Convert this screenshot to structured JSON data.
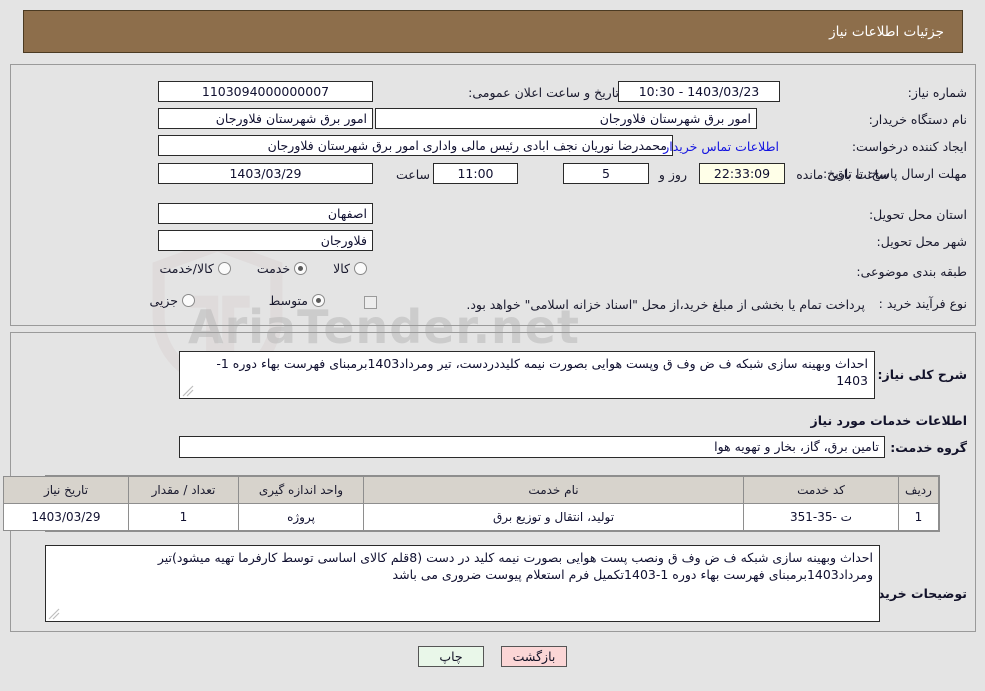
{
  "header": {
    "title": "جزئیات اطلاعات نیاز",
    "bg_color": "#8d6e4b",
    "text_color": "#ffffff"
  },
  "watermark": {
    "text": "AriaTender.net",
    "icon": "shield-icon"
  },
  "form": {
    "need_number_label": "شماره نیاز:",
    "need_number_value": "1103094000000007",
    "announce_datetime_label": "تاریخ و ساعت اعلان عمومی:",
    "announce_datetime_value": "1403/03/23 - 10:30",
    "buyer_org_label": "نام دستگاه خریدار:",
    "buyer_org_value": "امور برق شهرستان فلاورجان",
    "buyer_org_value2": "امور برق شهرستان فلاورجان",
    "requester_label": "ایجاد کننده درخواست:",
    "requester_value": "محمدرضا نوریان نجف ابادی رئیس مالی واداری  امور برق شهرستان فلاورجان",
    "contact_link_label": "اطلاعات تماس خریدار",
    "deadline_label": "مهلت ارسال پاسخ: تا تاریخ:",
    "deadline_date_value": "1403/03/29",
    "hour_label": "ساعت",
    "hour_value": "11:00",
    "days_value": "5",
    "days_label": "روز و",
    "countdown_value": "22:33:09",
    "remaining_label": "ساعت باقی مانده",
    "province_label": "استان محل تحویل:",
    "province_value": "اصفهان",
    "city_label": "شهر محل تحویل:",
    "city_value": "فلاورجان",
    "category_label": "طبقه بندی موضوعی:",
    "category_options": [
      {
        "label": "کالا",
        "selected": false
      },
      {
        "label": "خدمت",
        "selected": true
      },
      {
        "label": "کالا/خدمت",
        "selected": false
      }
    ],
    "process_label": "نوع فرآیند خرید :",
    "process_options": [
      {
        "label": "جزیی",
        "selected": false
      },
      {
        "label": "متوسط",
        "selected": true
      }
    ],
    "treasury_checkbox_checked": false,
    "treasury_note": "پرداخت تمام یا بخشی از مبلغ خرید،از محل \"اسناد خزانه اسلامی\" خواهد بود."
  },
  "summary": {
    "label": "شرح کلی نیاز:",
    "value": "احداث وبهینه سازی شبکه ف ض وف ق وپست هوایی بصورت نیمه کلیددردست، تیر ومرداد1403برمبنای فهرست بهاء دوره 1-1403"
  },
  "services_section": {
    "title": "اطلاعات خدمات مورد نیاز",
    "group_label": "گروه خدمت:",
    "group_value": "تامین برق، گاز، بخار و تهویه هوا",
    "table": {
      "columns": [
        "ردیف",
        "کد خدمت",
        "نام خدمت",
        "واحد اندازه گیری",
        "تعداد / مقدار",
        "تاریخ نیاز"
      ],
      "rows": [
        {
          "radif": "1",
          "code": "ت -35-351",
          "name": "تولید، انتقال و توزیع برق",
          "unit": "پروژه",
          "qty": "1",
          "date": "1403/03/29"
        }
      ]
    }
  },
  "buyer_notes": {
    "label": "توضیحات خریدار:",
    "value": "احداث وبهینه سازی شبکه ف ض وف ق ونصب پست هوایی بصورت نیمه کلید در دست (8قلم کالای اساسی توسط کارفرما تهیه میشود)تیر ومرداد1403برمبنای فهرست بهاء دوره 1-1403تکمیل فرم استعلام پیوست ضروری می باشد"
  },
  "buttons": {
    "print": "چاپ",
    "back": "بازگشت"
  }
}
